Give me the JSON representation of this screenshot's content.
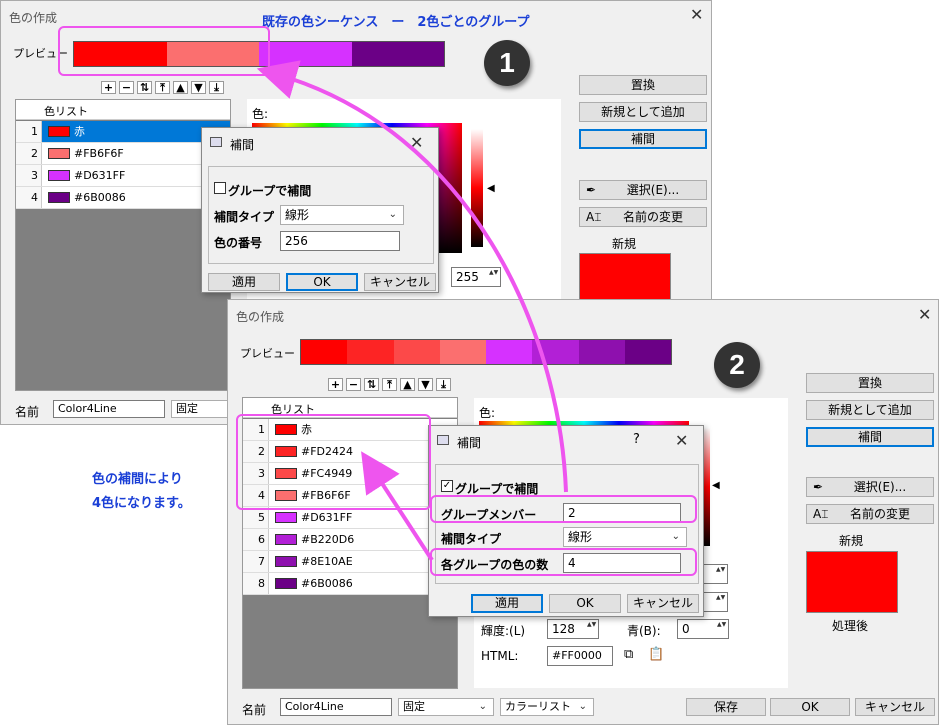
{
  "annotation": {
    "title": "既存の色シーケンス　ー　2色ごとのグループ",
    "note_line1": "色の補間により",
    "note_line2": "4色になります。",
    "badge1": "1",
    "badge2": "2"
  },
  "dlg1": {
    "title": "色の作成",
    "preview_label": "プレビュー",
    "preview_colors": [
      "#FF0000",
      "#FB6F6F",
      "#D631FF",
      "#6B0086"
    ],
    "list_header": "色リスト",
    "rows": [
      {
        "idx": "1",
        "label": "赤",
        "color": "#FF0000"
      },
      {
        "idx": "2",
        "label": "#FB6F6F",
        "color": "#FB6F6F"
      },
      {
        "idx": "3",
        "label": "#D631FF",
        "color": "#D631FF"
      },
      {
        "idx": "4",
        "label": "#6B0086",
        "color": "#6B0086"
      }
    ],
    "color_label": "色:",
    "btn_replace": "置換",
    "btn_add_new": "新規として追加",
    "btn_interp": "補間",
    "btn_select": "選択(E)...",
    "btn_rename": "名前の変更",
    "new_label": "新規",
    "name_label": "名前",
    "name_value": "Color4Line",
    "fixed_value": "固定",
    "spin_value": "255"
  },
  "sub1": {
    "title": "補間",
    "chk_group": "グループで補間",
    "type_label": "補間タイプ",
    "type_value": "線形",
    "count_label": "色の番号",
    "count_value": "256",
    "btn_apply": "適用",
    "btn_ok": "OK",
    "btn_cancel": "キャンセル"
  },
  "dlg2": {
    "title": "色の作成",
    "preview_label": "プレビュー",
    "preview_colors": [
      "#FF0000",
      "#FD2424",
      "#FC4949",
      "#FB6F6F",
      "#D631FF",
      "#B220D6",
      "#8E10AE",
      "#6B0086"
    ],
    "list_header": "色リスト",
    "rows": [
      {
        "idx": "1",
        "label": "赤",
        "color": "#FF0000"
      },
      {
        "idx": "2",
        "label": "#FD2424",
        "color": "#FD2424"
      },
      {
        "idx": "3",
        "label": "#FC4949",
        "color": "#FC4949"
      },
      {
        "idx": "4",
        "label": "#FB6F6F",
        "color": "#FB6F6F"
      },
      {
        "idx": "5",
        "label": "#D631FF",
        "color": "#D631FF"
      },
      {
        "idx": "6",
        "label": "#B220D6",
        "color": "#B220D6"
      },
      {
        "idx": "7",
        "label": "#8E10AE",
        "color": "#8E10AE"
      },
      {
        "idx": "8",
        "label": "#6B0086",
        "color": "#6B0086"
      }
    ],
    "color_label": "色:",
    "btn_replace": "置換",
    "btn_add_new": "新規として追加",
    "btn_interp": "補間",
    "btn_select": "選択(E)...",
    "btn_rename": "名前の変更",
    "new_label": "新規",
    "processed_label": "処理後",
    "brightness_label": "輝度:(L)",
    "brightness_value": "128",
    "blue_label": "青(B):",
    "blue_value": "0",
    "html_label": "HTML:",
    "html_value": "#FF0000",
    "name_label": "名前",
    "name_value": "Color4Line",
    "fixed_value": "固定",
    "colorlist_value": "カラーリスト",
    "btn_save": "保存",
    "btn_ok": "OK",
    "btn_cancel": "キャンセル"
  },
  "sub2": {
    "title": "補間",
    "help": "?",
    "chk_group": "グループで補間",
    "member_label": "グループメンバー",
    "member_value": "2",
    "type_label": "補間タイプ",
    "type_value": "線形",
    "per_group_label": "各グループの色の数",
    "per_group_value": "4",
    "btn_apply": "適用",
    "btn_ok": "OK",
    "btn_cancel": "キャンセル"
  }
}
